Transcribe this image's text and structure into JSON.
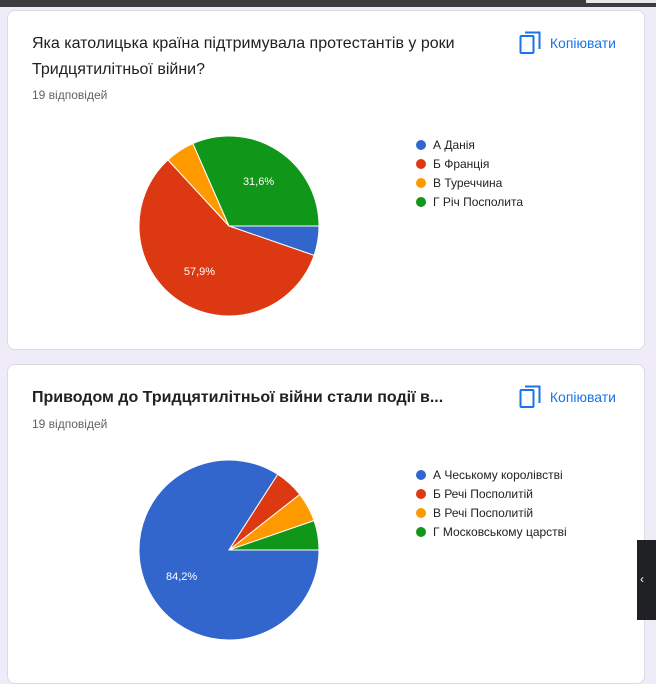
{
  "copy_label": "Копіювати",
  "colors": {
    "blue": "#3366cc",
    "red": "#dc3912",
    "orange": "#ff9900",
    "green": "#109618"
  },
  "questions": [
    {
      "title": "Яка католицька країна підтримувала протестантів у роки Тридцятилітньої війни?",
      "responses": "19 відповідей",
      "chart_data": {
        "type": "pie",
        "labels": [
          "А Данія",
          "Б Франція",
          "В Туреччина",
          "Г Річ Посполита"
        ],
        "values": [
          5.3,
          57.9,
          5.3,
          31.6
        ],
        "data_labels": [
          "",
          "57,9%",
          "",
          "31,6%"
        ],
        "colors": [
          "#3366cc",
          "#dc3912",
          "#ff9900",
          "#109618"
        ],
        "legend": "right"
      }
    },
    {
      "title": "Приводом до Тридцятилітньої війни стали події в...",
      "responses": "19 відповідей",
      "chart_data": {
        "type": "pie",
        "labels": [
          "А Чеському королівстві",
          "Б Речі Посполитій",
          "В Речі Посполитій",
          "Г Московському царстві"
        ],
        "values": [
          84.2,
          5.3,
          5.3,
          5.3
        ],
        "data_labels": [
          "84,2%",
          "",
          "",
          ""
        ],
        "colors": [
          "#3366cc",
          "#dc3912",
          "#ff9900",
          "#109618"
        ],
        "legend": "right"
      }
    }
  ]
}
